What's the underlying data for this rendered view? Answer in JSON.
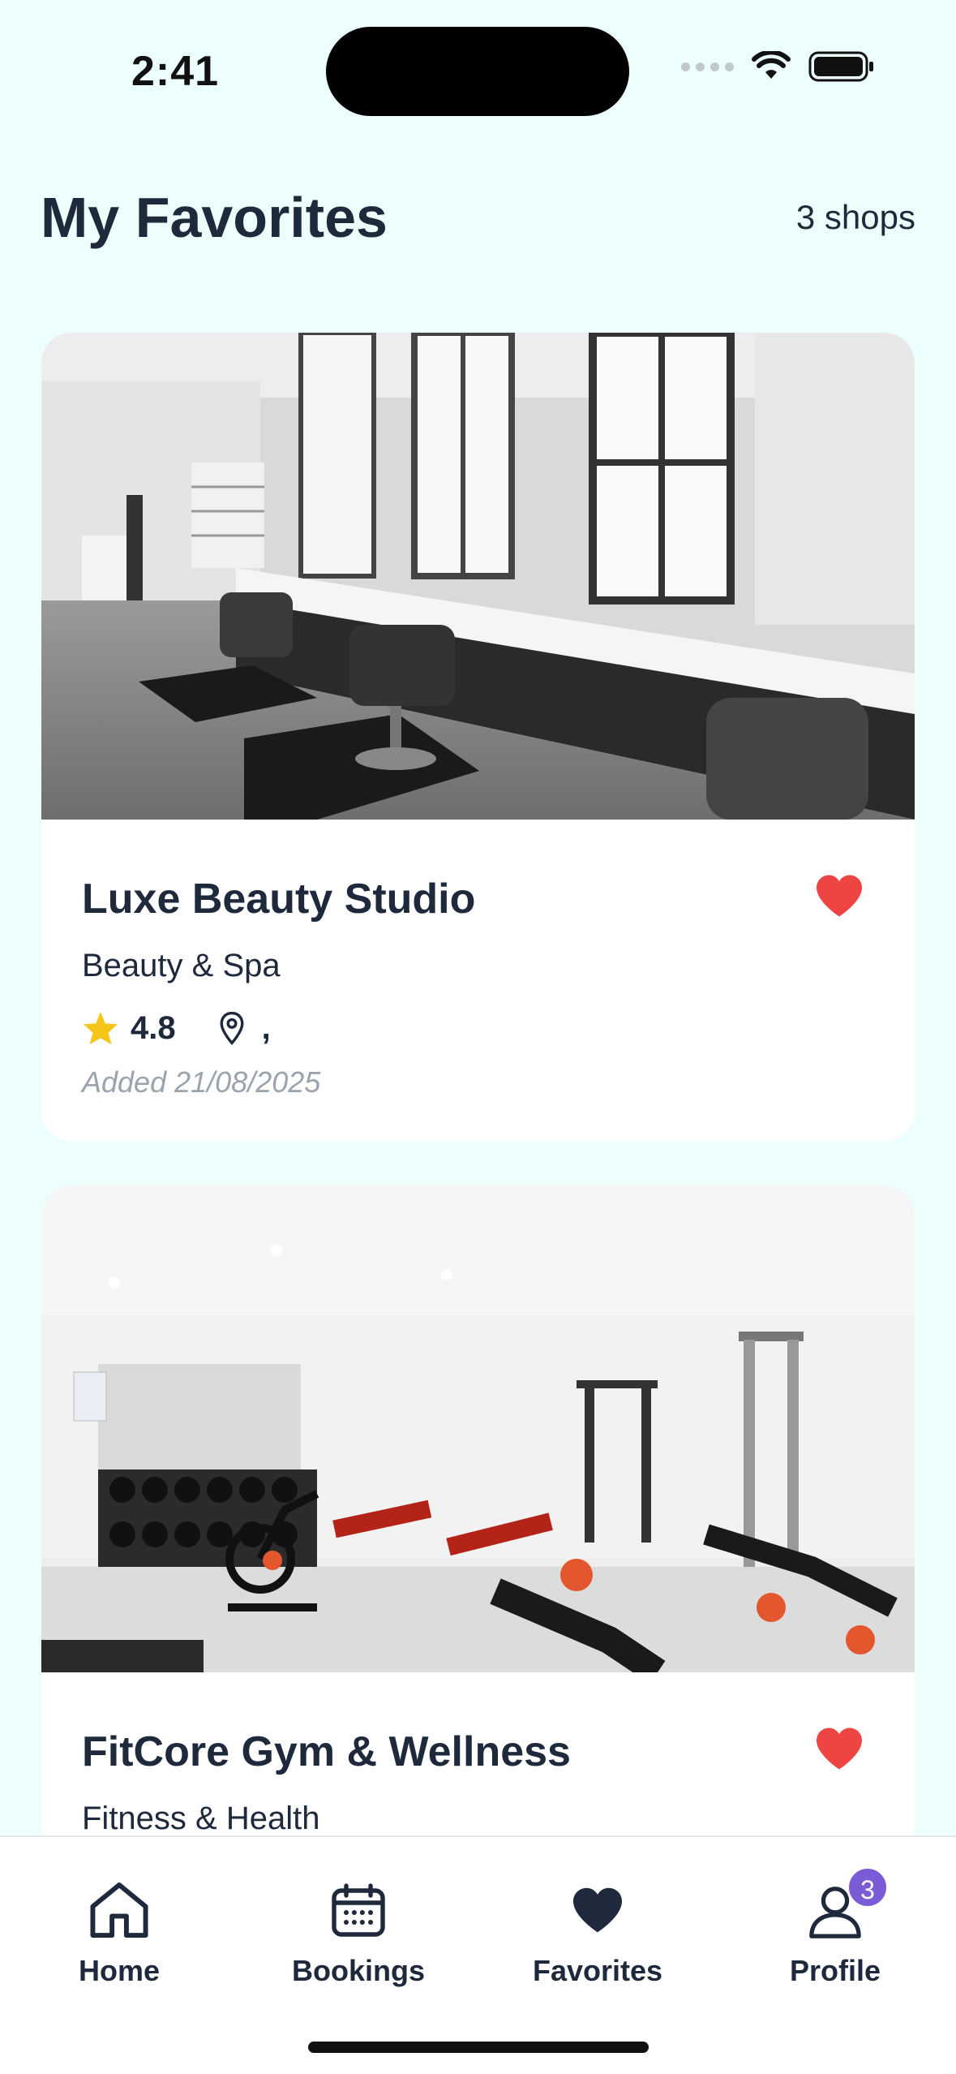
{
  "status_bar": {
    "time": "2:41"
  },
  "header": {
    "title": "My Favorites",
    "count": "3 shops"
  },
  "favorites": [
    {
      "name": "Luxe Beauty Studio",
      "category": "Beauty & Spa",
      "rating": "4.8",
      "location": ",",
      "added": "Added 21/08/2025",
      "image": "salon-interior-photo"
    },
    {
      "name": "FitCore Gym & Wellness",
      "category": "Fitness & Health",
      "image": "gym-interior-photo"
    }
  ],
  "nav": {
    "items": [
      {
        "label": "Home",
        "icon": "home-icon"
      },
      {
        "label": "Bookings",
        "icon": "calendar-icon"
      },
      {
        "label": "Favorites",
        "icon": "heart-icon"
      },
      {
        "label": "Profile",
        "icon": "user-icon"
      }
    ],
    "profile_badge": "3"
  },
  "colors": {
    "background": "#EDFFFC",
    "text": "#1E293B",
    "heart": "#EF4444",
    "star": "#F5C518",
    "badge": "#7C5CD6",
    "muted": "#9AA3AE"
  }
}
